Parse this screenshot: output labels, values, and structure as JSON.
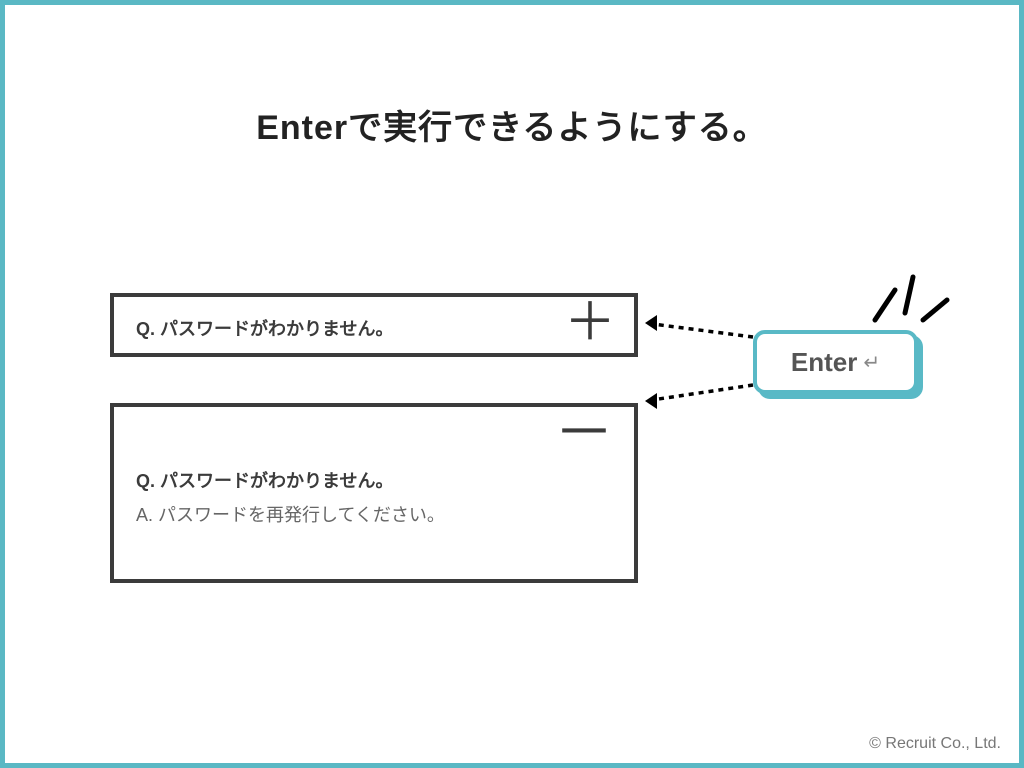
{
  "title": "Enterで実行できるようにする。",
  "faq": {
    "collapsed": {
      "question": "Q. パスワードがわかりません。",
      "icon_label": "＋"
    },
    "expanded": {
      "question": "Q. パスワードがわかりません。",
      "answer": "A. パスワードを再発行してください。",
      "icon_label": "－"
    }
  },
  "enter_button": {
    "label": "Enter",
    "return_glyph": "↵"
  },
  "copyright": "© Recruit Co., Ltd.",
  "colors": {
    "accent": "#5ab8c4",
    "border": "#3b3b3b"
  }
}
